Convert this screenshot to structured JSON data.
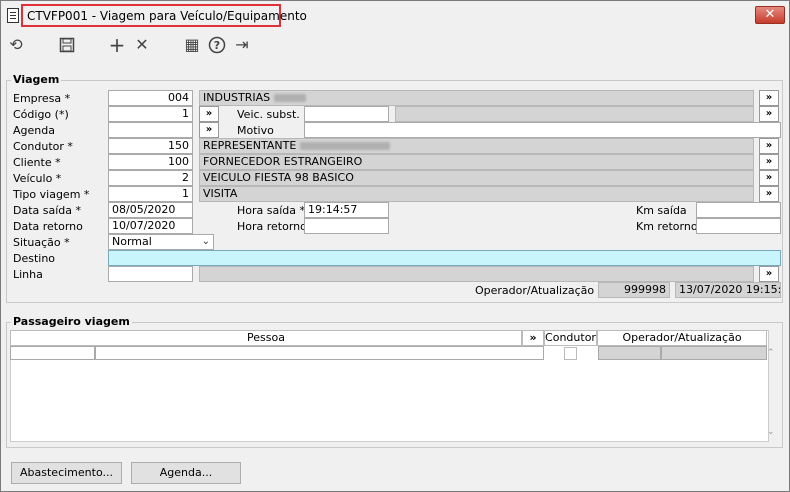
{
  "window": {
    "title": "CTVFP001 - Viagem para Veículo/Equipamento",
    "close_glyph": "✕"
  },
  "toolbar": {
    "undo_glyph": "⟲",
    "save_glyph": "▣",
    "add_glyph": "+",
    "delete_glyph": "✕",
    "calc_glyph": "▦",
    "help_glyph": "?",
    "exit_glyph": "⇥"
  },
  "viagem": {
    "group_label": "Viagem",
    "empresa": {
      "label": "Empresa *",
      "code": "004",
      "name": "INDUSTRIAS"
    },
    "codigo": {
      "label": "Código (*)",
      "value": "1"
    },
    "veic_subst": {
      "label": "Veic. subst."
    },
    "agenda": {
      "label": "Agenda",
      "value": ""
    },
    "motivo": {
      "label": "Motivo",
      "value": ""
    },
    "condutor": {
      "label": "Condutor *",
      "code": "150",
      "name": "REPRESENTANTE"
    },
    "cliente": {
      "label": "Cliente *",
      "code": "100",
      "name": "FORNECEDOR ESTRANGEIRO"
    },
    "veiculo": {
      "label": "Veículo *",
      "code": "2",
      "name": "VEICULO FIESTA 98 BASICO"
    },
    "tipo_viagem": {
      "label": "Tipo viagem *",
      "code": "1",
      "name": "VISITA"
    },
    "data_saida": {
      "label": "Data saída *",
      "value": "08/05/2020"
    },
    "hora_saida": {
      "label": "Hora saída *",
      "value": "19:14:57"
    },
    "km_saida": {
      "label": "Km saída",
      "value": ""
    },
    "data_retorno": {
      "label": "Data retorno",
      "value": "10/07/2020"
    },
    "hora_retorno": {
      "label": "Hora retorno",
      "value": ""
    },
    "km_retorno": {
      "label": "Km retorno",
      "value": ""
    },
    "situacao": {
      "label": "Situação *",
      "value": "Normal"
    },
    "destino": {
      "label": "Destino",
      "value": ""
    },
    "linha": {
      "label": "Linha",
      "value": ""
    },
    "operador": {
      "label": "Operador/Atualização",
      "code": "999998",
      "datetime": "13/07/2020 19:15:13"
    },
    "lookup_glyph": "»"
  },
  "passageiro": {
    "group_label": "Passageiro viagem",
    "columns": {
      "pessoa": "Pessoa",
      "condutor": "Condutor",
      "operador": "Operador/Atualização"
    },
    "lookup_glyph": "»"
  },
  "footer": {
    "abastecimento": "Abastecimento...",
    "agenda": "Agenda..."
  },
  "colors": {
    "destino_bg": "#c8f4fc",
    "title_highlight": "#e0303a",
    "close_btn": "#c63d2b"
  }
}
